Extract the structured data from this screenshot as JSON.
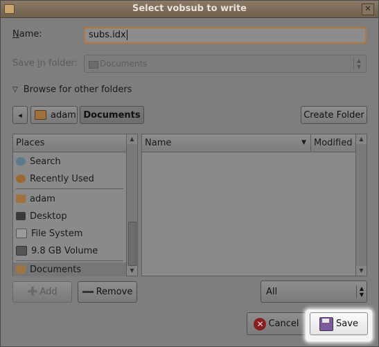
{
  "window": {
    "title": "Select vobsub to write"
  },
  "name": {
    "label": "Name:",
    "value": "subs.idx"
  },
  "save_in": {
    "label": "Save in folder:",
    "value": "Documents"
  },
  "browse": {
    "label": "Browse for other folders"
  },
  "path": {
    "back": "◂",
    "crumbs": [
      "adam",
      "Documents"
    ],
    "create_folder": "Create Folder"
  },
  "places": {
    "header": "Places",
    "items": [
      {
        "label": "Search",
        "icon": "search-icon"
      },
      {
        "label": "Recently Used",
        "icon": "recent-icon"
      },
      {
        "label": "adam",
        "icon": "home-folder-icon"
      },
      {
        "label": "Desktop",
        "icon": "desktop-icon"
      },
      {
        "label": "File System",
        "icon": "drive-icon"
      },
      {
        "label": "9.8 GB Volume",
        "icon": "volume-icon"
      },
      {
        "label": "Documents",
        "icon": "folder-icon"
      }
    ]
  },
  "files": {
    "col_name": "Name",
    "col_modified": "Modified"
  },
  "buttons": {
    "add": "Add",
    "remove": "Remove",
    "cancel": "Cancel",
    "save": "Save"
  },
  "filter": {
    "value": "All"
  }
}
